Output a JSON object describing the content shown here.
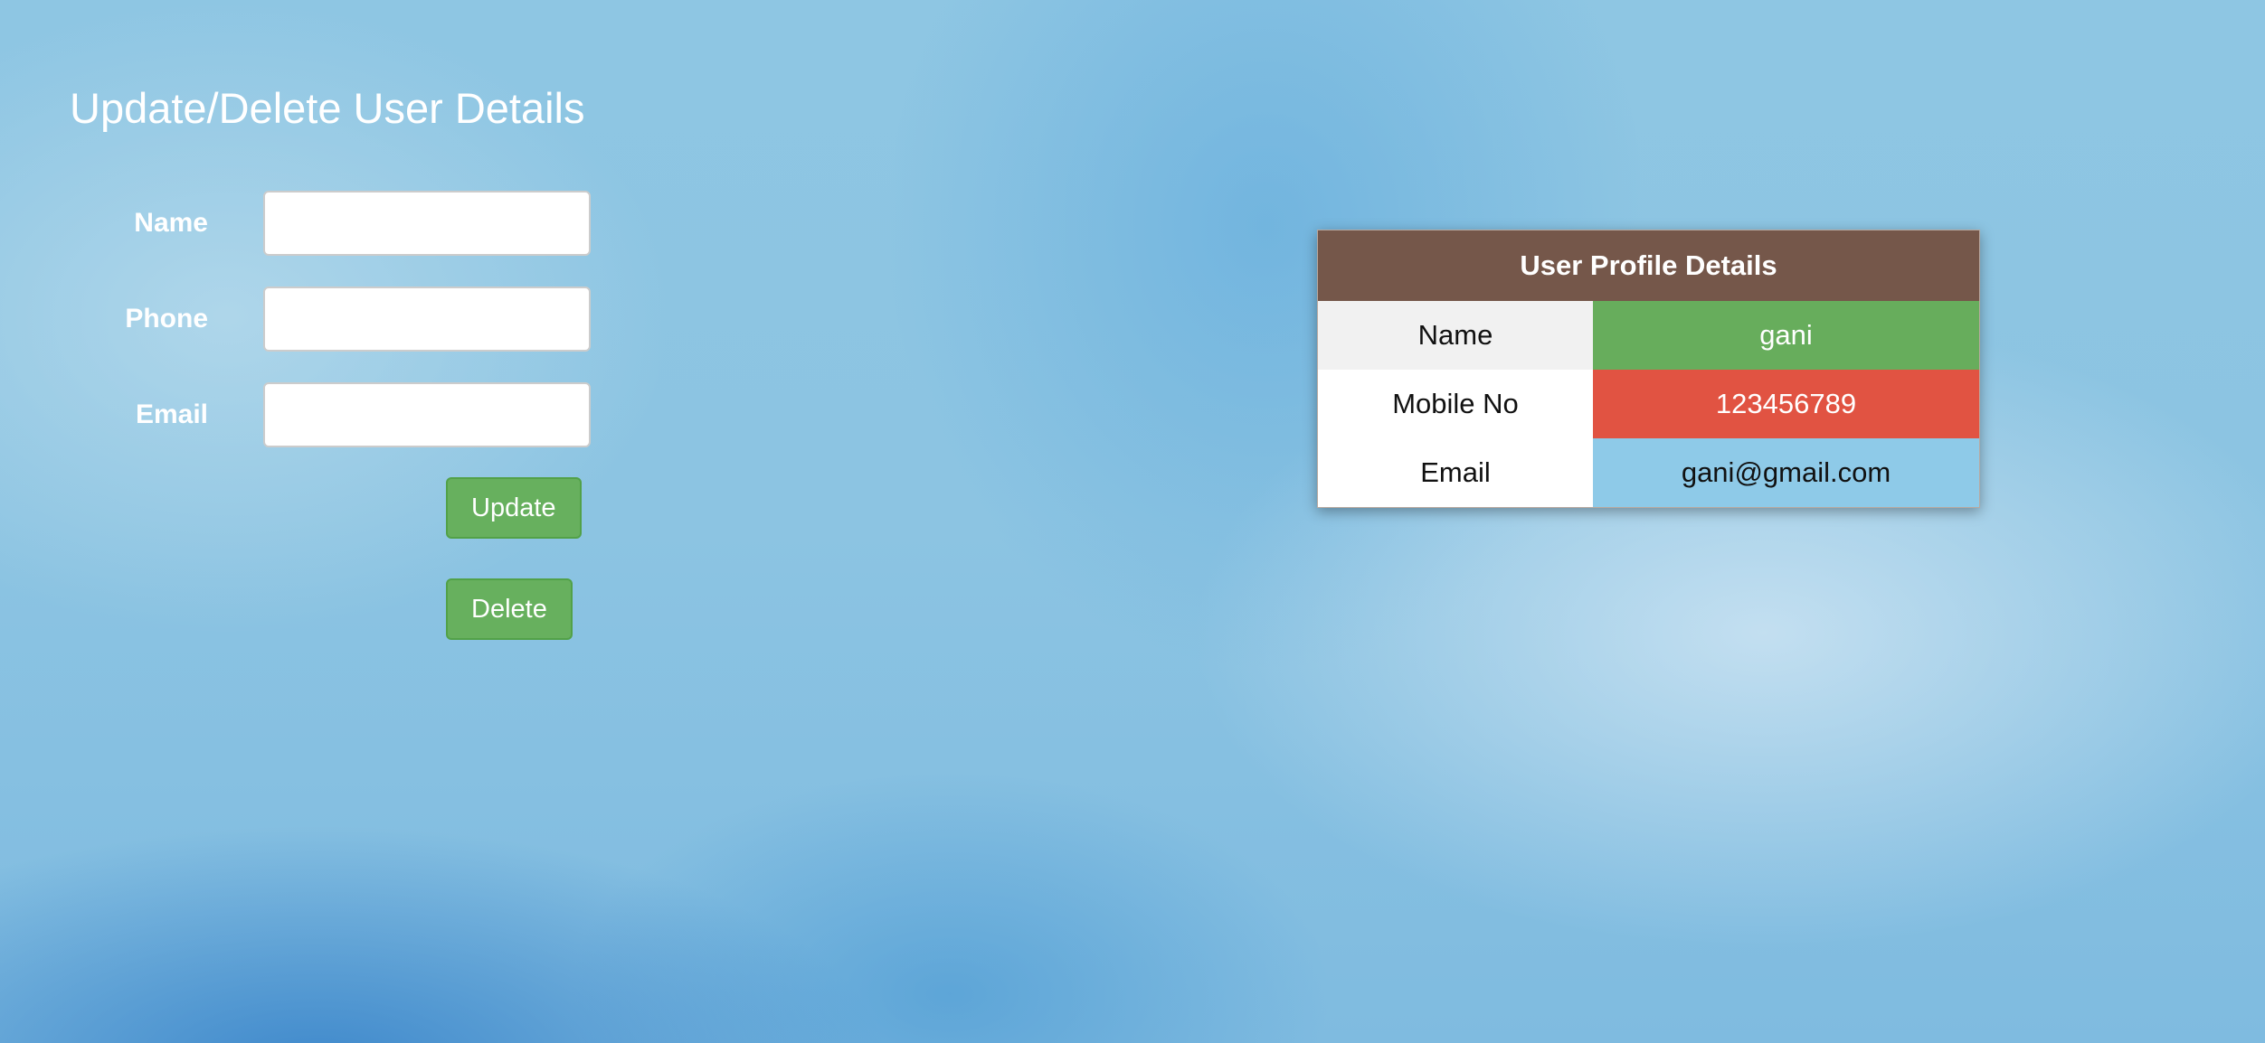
{
  "page": {
    "title": "Update/Delete User Details"
  },
  "form": {
    "fields": [
      {
        "label": "Name",
        "value": "",
        "placeholder": ""
      },
      {
        "label": "Phone",
        "value": "",
        "placeholder": ""
      },
      {
        "label": "Email",
        "value": "",
        "placeholder": ""
      }
    ],
    "update_label": "Update",
    "delete_label": "Delete"
  },
  "profile": {
    "title": "User Profile Details",
    "rows": [
      {
        "label": "Name",
        "value": "gani"
      },
      {
        "label": "Mobile No",
        "value": "123456789"
      },
      {
        "label": "Email",
        "value": "gani@gmail.com"
      }
    ]
  },
  "colors": {
    "button_green": "#67b05e",
    "header_brown": "#75574a",
    "name_green": "#67ad5c",
    "mobile_red": "#e15342",
    "email_blue": "#8ecae8"
  }
}
